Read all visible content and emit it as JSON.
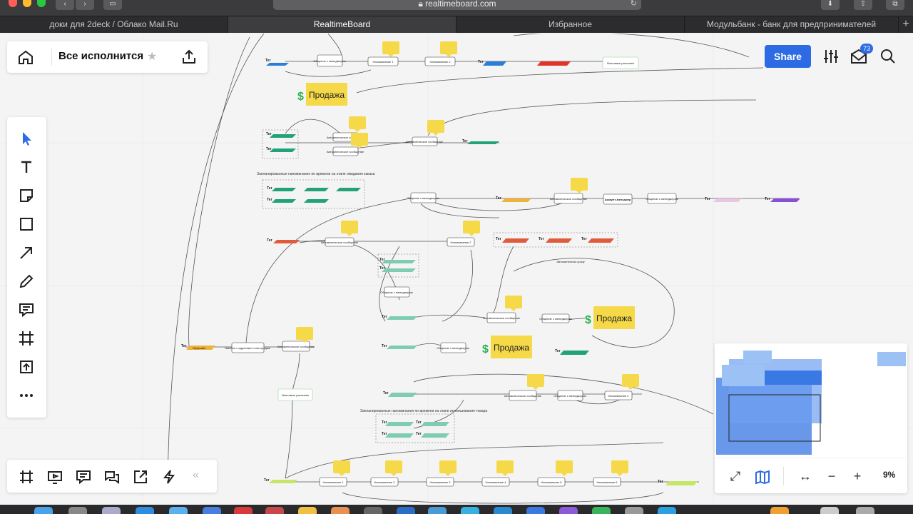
{
  "browser": {
    "url": "realtimeboard.com",
    "tabs": [
      {
        "label": "доки для 2deck / Облако Mail.Ru",
        "active": false
      },
      {
        "label": "RealtimeBoard",
        "active": true
      },
      {
        "label": "Избранное",
        "active": false
      },
      {
        "label": "Модульбанк - банк для предпринимателей",
        "active": false
      }
    ],
    "new_tab_label": "+"
  },
  "board": {
    "title": "Все исполнится",
    "share_label": "Share",
    "notification_count": "73",
    "zoom_level": "9%"
  },
  "toolbar": {
    "tools": [
      "cursor-icon",
      "text-icon",
      "sticky-note-icon",
      "rectangle-icon",
      "arrow-icon",
      "pen-icon",
      "comment-icon",
      "frame-icon",
      "upload-icon",
      "more-icon"
    ]
  },
  "bottom_toolbar": {
    "tools": [
      "frames-icon",
      "presentation-icon",
      "notes-icon",
      "chat-icon",
      "share-screen-icon",
      "lightning-icon"
    ],
    "collapse_label": "«"
  },
  "canvas": {
    "sale_label": "Продажа",
    "mass_mailing_label": "Массовые рассылки",
    "communication_label": "Общение с менеджером",
    "auto_message_label": "Автоматическое сообщение",
    "reminder_labels": [
      "Напоминание 1",
      "Напоминание 2",
      "Напоминание 3",
      "Напоминание 4",
      "Напоминание 5",
      "Напоминание 6"
    ],
    "tag_label": "Тег",
    "offline_label": "Оффлайн",
    "template_label": "Шаблон с адресами точек продаж",
    "section_order_waiting": "Запланированные напоминания по времени на этапе ожидания заказа",
    "section_product_use": "Запланированные напоминания по времени на этапе использования товара",
    "auto_immediately": "Автоматически сразу",
    "account_manager": "Аккаунт-менеджер"
  },
  "colors": {
    "accent": "#2d6be4",
    "sticky": "#f5d949",
    "tag_green": "#21a27a",
    "tag_red": "#e05a3c",
    "tag_orange": "#f0b23b",
    "tag_purple": "#8a4fd8",
    "tag_blue": "#2a7ed6",
    "dollar": "#2bb24c"
  }
}
